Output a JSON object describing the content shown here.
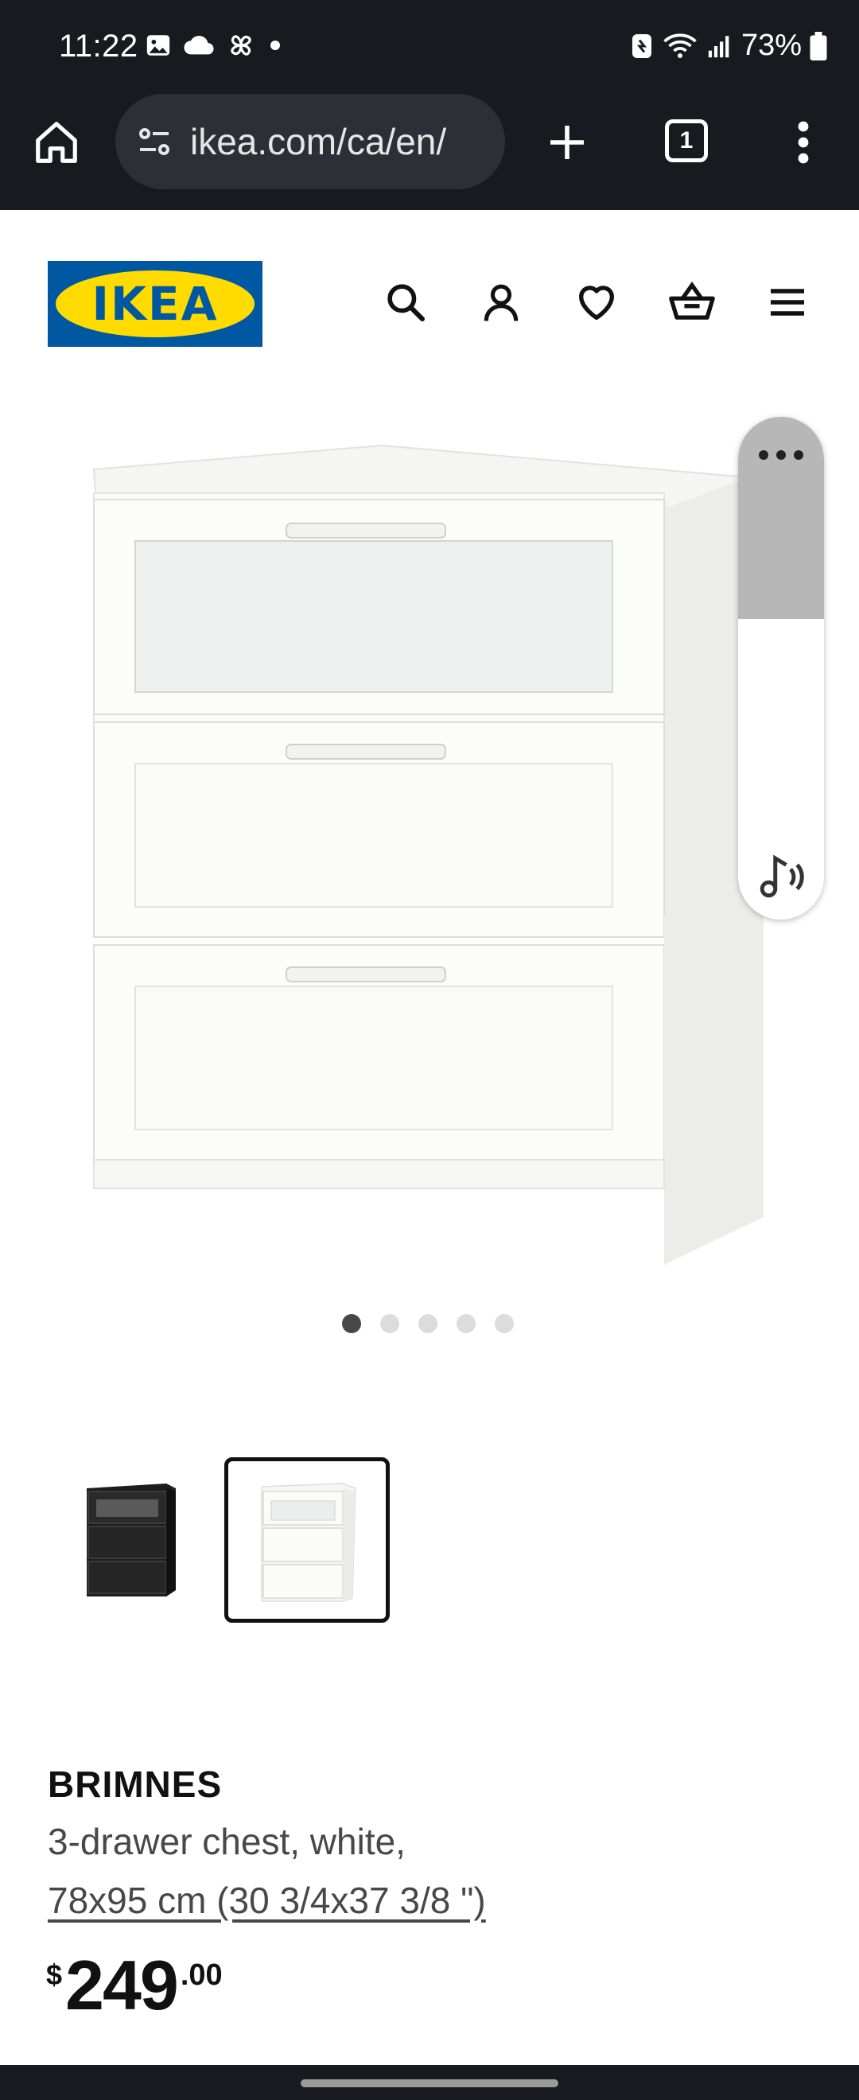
{
  "status_bar": {
    "time": "11:22",
    "battery": "73%"
  },
  "browser": {
    "url": "ikea.com/ca/en/",
    "tab_count": "1"
  },
  "header": {
    "logo_text": "IKEA",
    "icons": [
      "search-icon",
      "account-icon",
      "wishlist-icon",
      "cart-icon",
      "menu-icon"
    ]
  },
  "gallery": {
    "image_count": 5,
    "active_index": 0
  },
  "side_panel": {
    "icons": [
      "more-icon",
      "music-icon"
    ]
  },
  "product": {
    "name": "BRIMNES",
    "description": "3-drawer chest, white,",
    "size": "78x95 cm (30 3/4x37 3/8 \")",
    "price_currency": "$",
    "price_integer": "249",
    "price_decimal": ".00"
  },
  "colors": {
    "ikea_blue": "#0058a3",
    "ikea_yellow": "#ffdb00",
    "system_bar": "#181a1f"
  }
}
